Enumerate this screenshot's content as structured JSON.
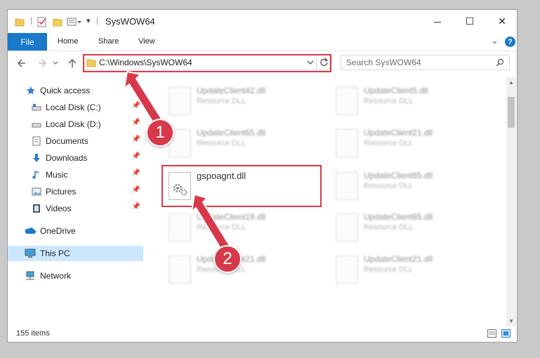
{
  "window": {
    "title": "SysWOW64",
    "minimize": "─",
    "maximize": "☐",
    "close": "✕"
  },
  "ribbon": {
    "tabs": [
      "File",
      "Home",
      "Share",
      "View"
    ],
    "collapse": "⌄",
    "help": "?"
  },
  "nav": {
    "path": "C:\\Windows\\SysWOW64",
    "search_placeholder": "Search SysWOW64"
  },
  "sidebar": {
    "items": [
      {
        "label": "Quick access",
        "icon": "star-icon",
        "pinned": false
      },
      {
        "label": "Local Disk (C:)",
        "icon": "drive-icon",
        "pinned": true
      },
      {
        "label": "Local Disk (D:)",
        "icon": "drive-icon",
        "pinned": true
      },
      {
        "label": "Documents",
        "icon": "documents-icon",
        "pinned": true
      },
      {
        "label": "Downloads",
        "icon": "download-icon",
        "pinned": true
      },
      {
        "label": "Music",
        "icon": "music-icon",
        "pinned": true
      },
      {
        "label": "Pictures",
        "icon": "pictures-icon",
        "pinned": true
      },
      {
        "label": "Videos",
        "icon": "videos-icon",
        "pinned": true
      },
      {
        "label": "OneDrive",
        "icon": "cloud-icon",
        "pinned": false
      },
      {
        "label": "This PC",
        "icon": "computer-icon",
        "pinned": false,
        "selected": true
      },
      {
        "label": "Network",
        "icon": "network-icon",
        "pinned": false
      }
    ]
  },
  "files": [
    {
      "name": "UpdateClient42.dll",
      "type": "Resource DLL"
    },
    {
      "name": "UpdateClient5.dll",
      "type": "Resource DLL"
    },
    {
      "name": "UpdateClient65.dll",
      "type": "Resource DLL"
    },
    {
      "name": "UpdateClient21.dll",
      "type": "Resource DLL"
    },
    {
      "name": "gspoagnt.dll",
      "type": ""
    },
    {
      "name": "UpdateClient65.dll",
      "type": "Resource DLL"
    },
    {
      "name": "UpdateClient19.dll",
      "type": "Resource DLL"
    },
    {
      "name": "UpdateClient65.dll",
      "type": "Resource DLL"
    },
    {
      "name": "UpdateClient21.dll",
      "type": "Resource DLL"
    },
    {
      "name": "UpdateClient21.dll",
      "type": "Resource DLL"
    }
  ],
  "status": {
    "count": "155 items"
  },
  "annotations": {
    "step1": "1",
    "step2": "2",
    "color": "#d8394a"
  }
}
